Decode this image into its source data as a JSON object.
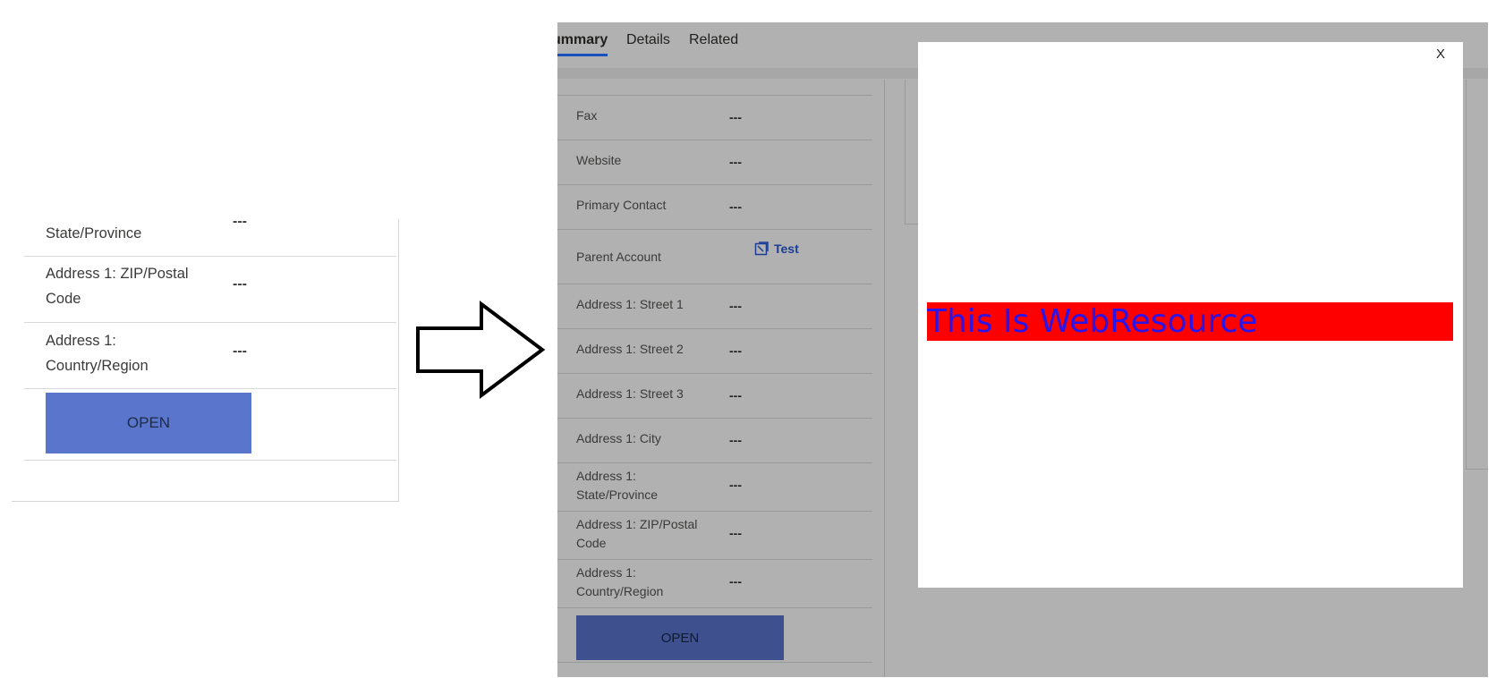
{
  "left_panel": {
    "rows": [
      {
        "label": "State/Province",
        "value": "---"
      },
      {
        "label": "Address 1: ZIP/Postal Code",
        "value": "---"
      },
      {
        "label": "Address 1: Country/Region",
        "value": "---"
      }
    ],
    "open_button": "OPEN"
  },
  "crm": {
    "tabs": [
      {
        "label": "ummary",
        "active": true
      },
      {
        "label": "Details",
        "active": false
      },
      {
        "label": "Related",
        "active": false
      }
    ],
    "fields": [
      {
        "label": "Fax",
        "value": "---"
      },
      {
        "label": "Website",
        "value": "---"
      },
      {
        "label": "Primary Contact",
        "value": "---"
      },
      {
        "label": "Parent Account",
        "value": "Test"
      },
      {
        "label": "Address 1: Street 1",
        "value": "---"
      },
      {
        "label": "Address 1: Street 2",
        "value": "---"
      },
      {
        "label": "Address 1: Street 3",
        "value": "---"
      },
      {
        "label": "Address 1: City",
        "value": "---"
      },
      {
        "label": "Address 1: State/Province",
        "value": "---"
      },
      {
        "label": "Address 1: ZIP/Postal Code",
        "value": "---"
      },
      {
        "label": "Address 1: Country/Region",
        "value": "---"
      }
    ],
    "open_button": "OPEN"
  },
  "dialog": {
    "close_label": "X",
    "banner_text": "This Is WebResource",
    "banner_bg": "#ff0000",
    "banner_text_color": "#2a14e8"
  },
  "colors": {
    "overlay": "#b1b1b1",
    "left_button": "#5a76cc",
    "right_button": "#3e508e",
    "tab_underline": "#1b4fbd"
  }
}
